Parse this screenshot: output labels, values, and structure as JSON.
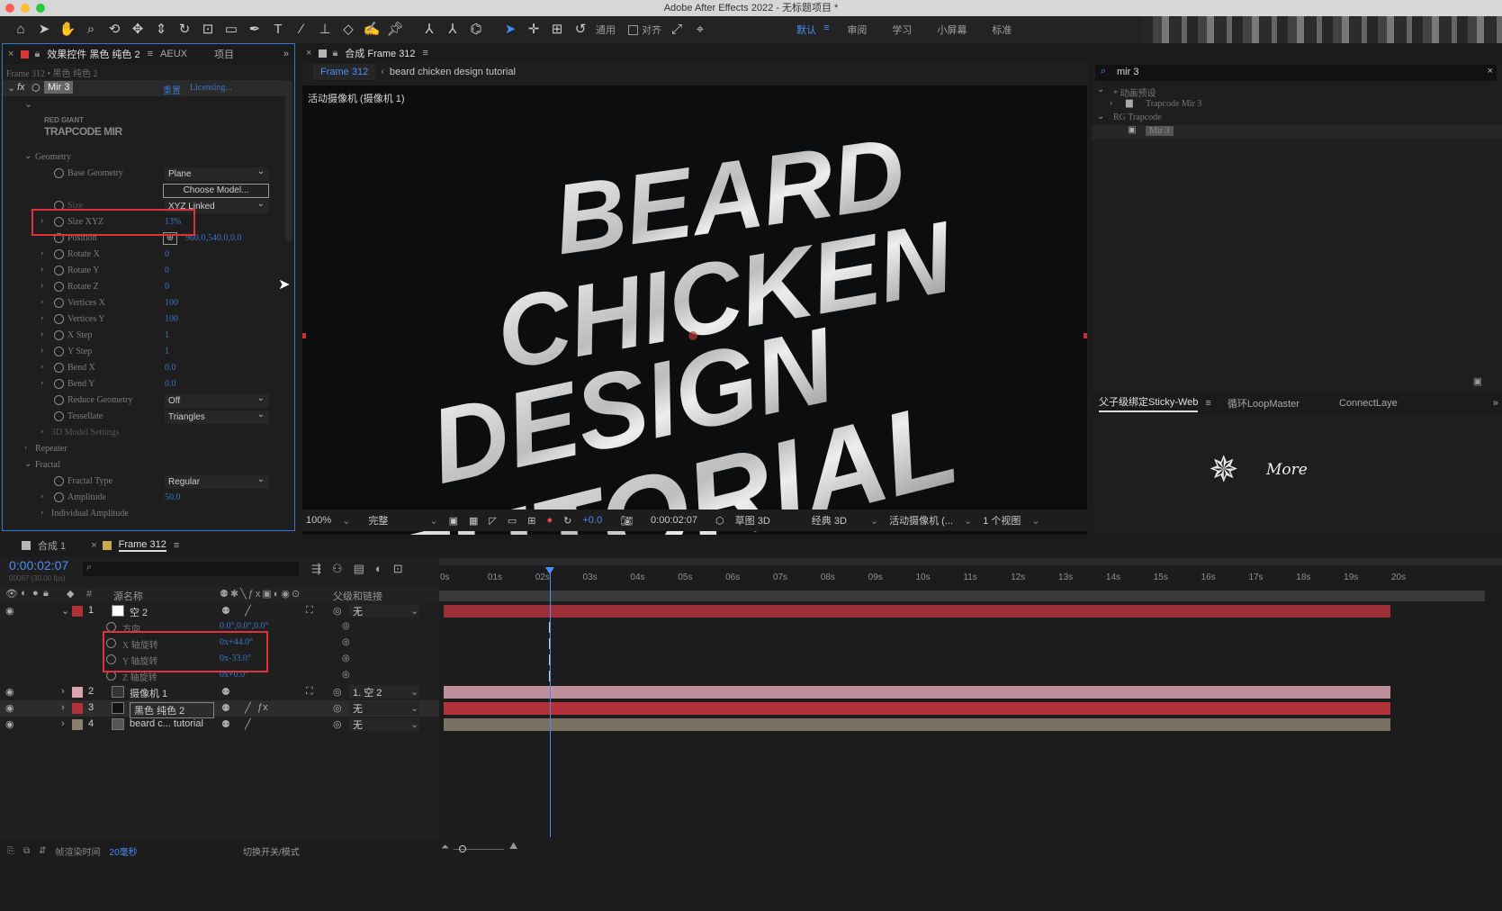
{
  "app_title": "Adobe After Effects 2022 - 无标题项目 *",
  "colors": {
    "accent": "#4a8df6",
    "highlight_box": "#e0323a",
    "layer_red": "#b2323a",
    "layer_pink": "#9d7c86",
    "layer_tan": "#8b806e",
    "panel_border": "#2f7ad6"
  },
  "toolbar": {
    "tools": [
      "home-icon",
      "selection-arrow-icon",
      "hand-icon",
      "zoom-icon",
      "orbit-camera-icon",
      "pan-camera-icon",
      "dolly-camera-icon",
      "rotate-icon",
      "pan-behind-icon",
      "rectangle-icon",
      "pen-icon",
      "type-icon",
      "brush-icon",
      "clone-stamp-icon",
      "eraser-icon",
      "roto-brush-icon",
      "puppet-pin-icon",
      "axis-local-icon",
      "axis-world-icon",
      "axis-view-icon",
      "selection-arrow-icon",
      "move-icon",
      "rotate-cam-icon",
      "reset-icon"
    ],
    "label_general": "通用",
    "label_align": "对齐",
    "workspaces": [
      "默认",
      "审阅",
      "学习",
      "小屏幕",
      "标准"
    ],
    "active_workspace": "默认"
  },
  "effect_panel": {
    "tab_title": "效果控件 黑色 纯色 2",
    "tab_aeux": "AEUX",
    "tab_project": "项目",
    "breadcrumb": "Frame 312 • 黑色 纯色 2",
    "effect_name": "Mir 3",
    "reset": "重置",
    "licensing": "Licensing...",
    "brand_small": "RED GIANT",
    "brand_big": "TRAPCODE MIR",
    "rows": [
      {
        "type": "group",
        "label": "Geometry",
        "indent": 0
      },
      {
        "type": "prop",
        "label": "Base Geometry",
        "dropdown": "Plane",
        "stopwatch": true
      },
      {
        "type": "button",
        "label": "Choose Model..."
      },
      {
        "type": "prop",
        "label": "Size",
        "dropdown": "XYZ Linked",
        "stopwatch": true,
        "dim": true
      },
      {
        "type": "prop",
        "label": "Size XYZ",
        "value": "13%",
        "stopwatch": true,
        "twirl": true
      },
      {
        "type": "prop",
        "label": "Position",
        "value": "960.0,540.0,0.0",
        "stopwatch": true,
        "target": true
      },
      {
        "type": "prop",
        "label": "Rotate X",
        "value": "0",
        "stopwatch": true,
        "twirl": true
      },
      {
        "type": "prop",
        "label": "Rotate Y",
        "value": "0",
        "stopwatch": true,
        "twirl": true
      },
      {
        "type": "prop",
        "label": "Rotate Z",
        "value": "0",
        "stopwatch": true,
        "twirl": true
      },
      {
        "type": "prop",
        "label": "Vertices X",
        "value": "100",
        "stopwatch": true,
        "twirl": true
      },
      {
        "type": "prop",
        "label": "Vertices Y",
        "value": "100",
        "stopwatch": true,
        "twirl": true
      },
      {
        "type": "prop",
        "label": "X Step",
        "value": "1",
        "stopwatch": true,
        "twirl": true
      },
      {
        "type": "prop",
        "label": "Y Step",
        "value": "1",
        "stopwatch": true,
        "twirl": true
      },
      {
        "type": "prop",
        "label": "Bend X",
        "value": "0.0",
        "stopwatch": true,
        "twirl": true
      },
      {
        "type": "prop",
        "label": "Bend Y",
        "value": "0.0",
        "stopwatch": true,
        "twirl": true
      },
      {
        "type": "prop",
        "label": "Reduce Geometry",
        "dropdown": "Off",
        "stopwatch": true
      },
      {
        "type": "prop",
        "label": "Tessellate",
        "dropdown": "Triangles",
        "stopwatch": true
      },
      {
        "type": "sub",
        "label": "3D Model Settings",
        "dim": true
      },
      {
        "type": "group",
        "label": "Repeater",
        "collapsed": true
      },
      {
        "type": "group",
        "label": "Fractal"
      },
      {
        "type": "prop",
        "label": "Fractal Type",
        "dropdown": "Regular",
        "stopwatch": true
      },
      {
        "type": "prop",
        "label": "Amplitude",
        "value": "50.0",
        "stopwatch": true,
        "twirl": true
      },
      {
        "type": "sub",
        "label": "Individual Amplitude"
      }
    ]
  },
  "comp_panel": {
    "tab_title": "合成 Frame 312",
    "crumb_active": "Frame 312",
    "crumb_next": "beard chicken design tutorial",
    "camera_label": "活动摄像机 (摄像机 1)",
    "art_lines": [
      "BEARD",
      "CHICKEN",
      "DESIGN",
      "TUTORIAL"
    ],
    "footer": {
      "zoom": "100%",
      "quality": "完整",
      "exposure": "+0.0",
      "timecode": "0:00:02:07",
      "draft3d": "草图 3D",
      "renderer": "经典 3D",
      "camera": "活动摄像机 (...",
      "views": "1 个视图"
    }
  },
  "effects_presets": {
    "search_value": "mir 3",
    "tree": [
      {
        "label": "* 动画预设",
        "level": 0,
        "expanded": true
      },
      {
        "label": "Trapcode Mir 3",
        "level": 1,
        "folder": true
      },
      {
        "label": "RG Trapcode",
        "level": 0,
        "expanded": true
      },
      {
        "label": "Mir 3",
        "level": 1,
        "selected": true
      }
    ]
  },
  "sticky_panel": {
    "tabs": [
      "父子级绑定Sticky-Web",
      "循环LoopMaster",
      "ConnectLaye"
    ],
    "more": "More"
  },
  "timeline": {
    "tabs": [
      "合成 1",
      "Frame 312"
    ],
    "timecode": "0:00:02:07",
    "sub_timecode": "00067 (30.00 fps)",
    "col_source": "源名称",
    "col_parent": "父级和链接",
    "ruler": [
      "0s",
      "01s",
      "02s",
      "03s",
      "04s",
      "05s",
      "06s",
      "07s",
      "08s",
      "09s",
      "10s",
      "11s",
      "12s",
      "13s",
      "14s",
      "15s",
      "16s",
      "17s",
      "18s",
      "19s",
      "20s"
    ],
    "playhead_seconds": 2.23,
    "duration_seconds": 20,
    "layers": [
      {
        "num": "1",
        "name": "空 2",
        "parent": "无",
        "color": "#b2323a",
        "expanded": true
      },
      {
        "num": "2",
        "name": "摄像机 1",
        "parent": "1. 空 2",
        "color": "#d9a4b2"
      },
      {
        "num": "3",
        "name": "黑色 纯色 2",
        "parent": "无",
        "color": "#b2323a",
        "selected": true
      },
      {
        "num": "4",
        "name": "beard c... tutorial",
        "parent": "无",
        "color": "#8b806e"
      }
    ],
    "sub_props": [
      {
        "label": "方向",
        "value": "0.0°,0.0°,0.0°"
      },
      {
        "label": "X 轴旋转",
        "value": "0x+44.0°"
      },
      {
        "label": "Y 轴旋转",
        "value": "0x-33.0°"
      },
      {
        "label": "Z 轴旋转",
        "value": "0x+0.0°"
      }
    ],
    "status": {
      "render_label": "帧渲染时间",
      "render_time": "20毫秒",
      "toggle": "切换开关/模式"
    }
  }
}
